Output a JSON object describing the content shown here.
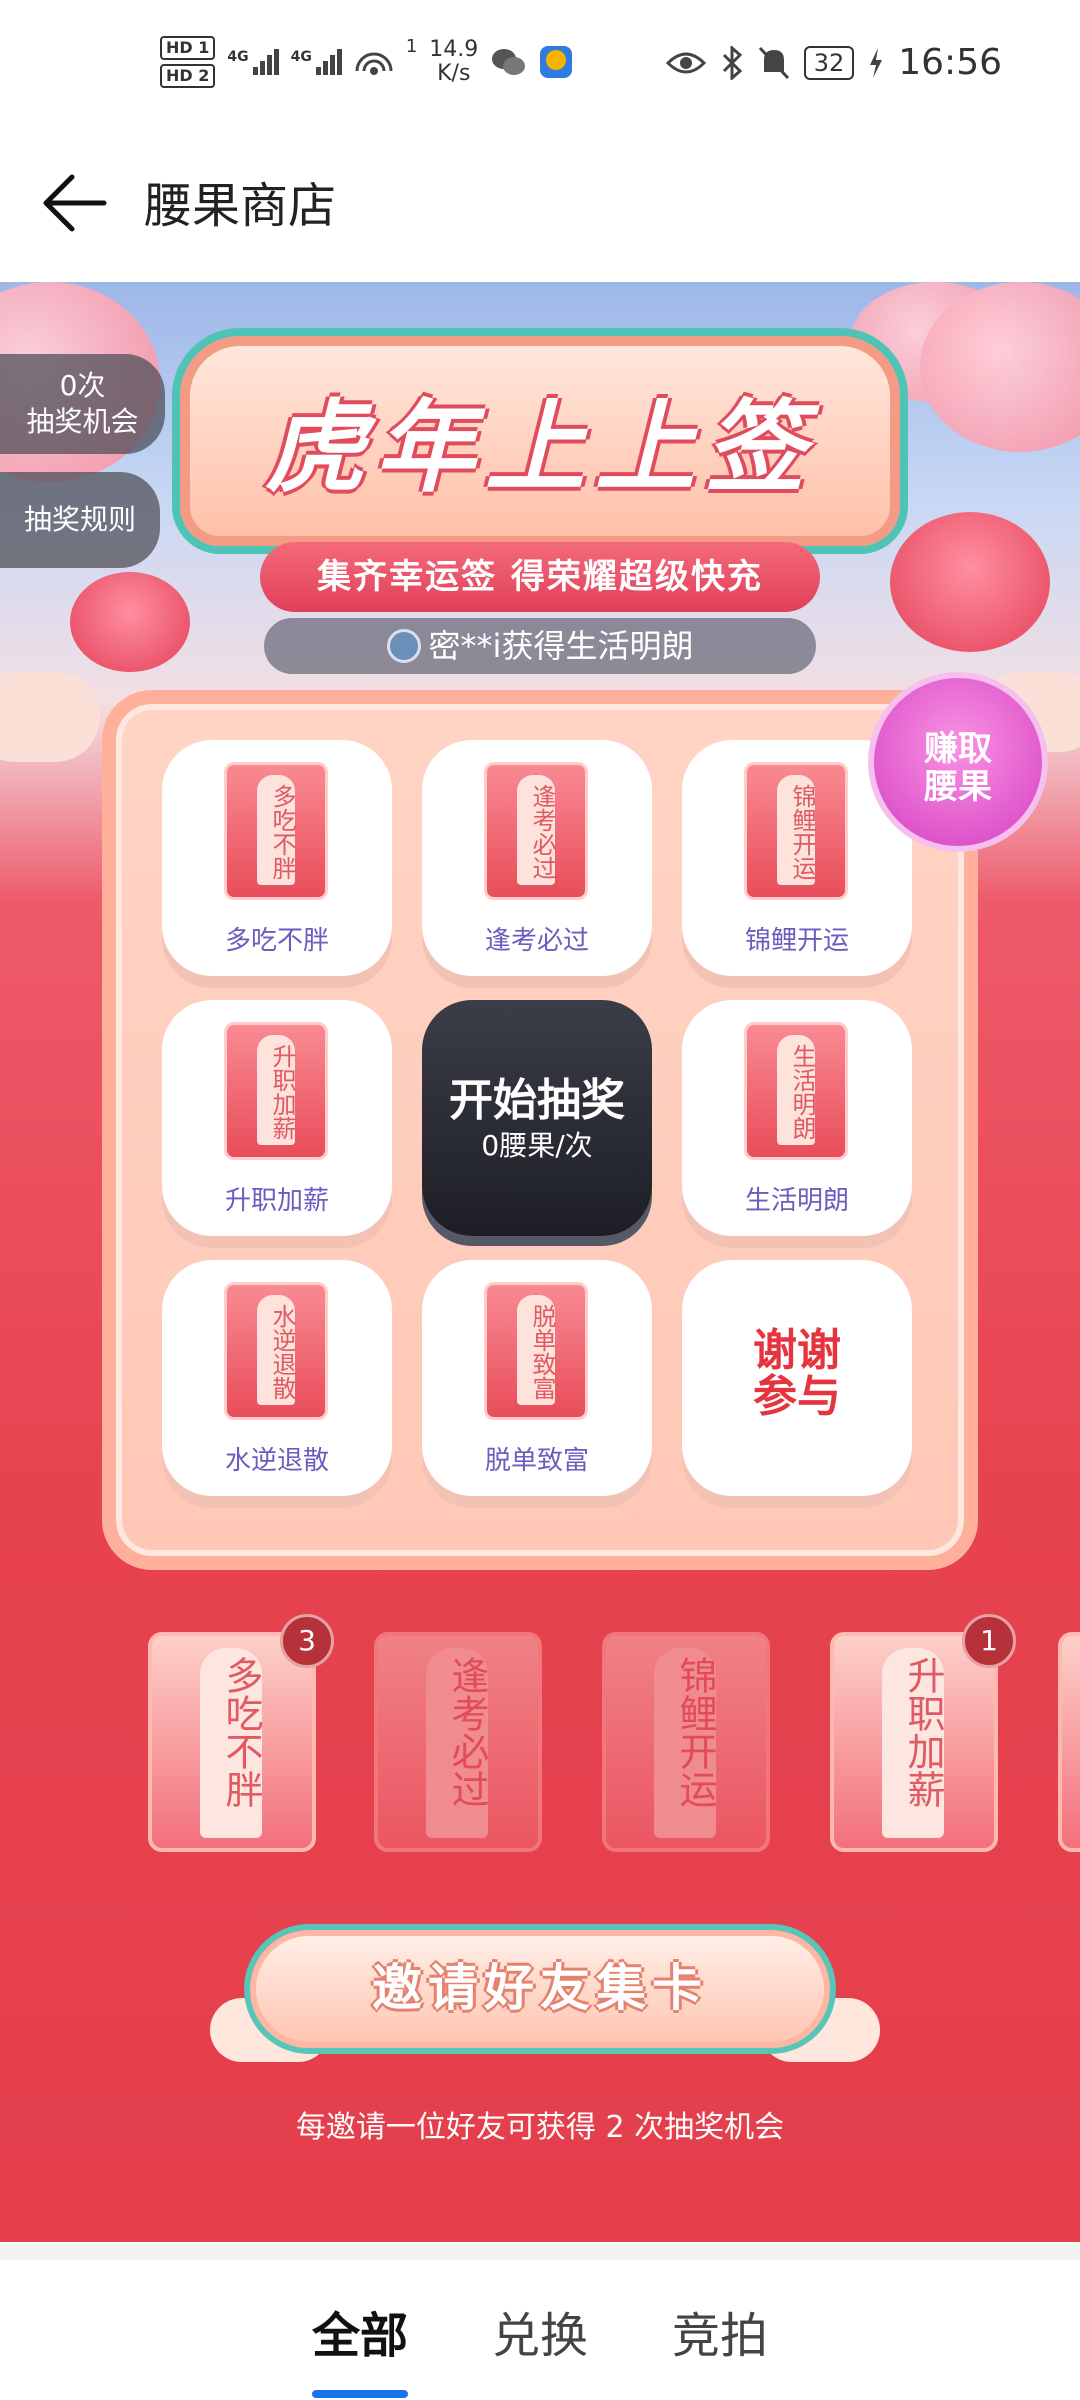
{
  "status_bar": {
    "hd1": "HD 1",
    "hd2": "HD 2",
    "net1": "4G",
    "net2": "4G",
    "hotspot_count": "1",
    "rate_value": "14.9",
    "rate_unit": "K/s",
    "battery": "32",
    "time": "16:56"
  },
  "header": {
    "title": "腰果商店"
  },
  "side": {
    "chance_count": "0次",
    "chance_label": "抽奖机会",
    "rules": "抽奖规则"
  },
  "banner": {
    "title": "虎年上上签",
    "subtitle": "集齐幸运签 得荣耀超级快充"
  },
  "winner_text": "密**i获得生活明朗",
  "earn_button": {
    "line1": "赚取",
    "line2": "腰果"
  },
  "grid": {
    "cells": [
      {
        "card": "多吃不胖",
        "label": "多吃不胖"
      },
      {
        "card": "逢考必过",
        "label": "逢考必过"
      },
      {
        "card": "锦鲤开运",
        "label": "锦鲤开运"
      },
      {
        "card": "升职加薪",
        "label": "升职加薪"
      },
      {
        "card": "生活明朗",
        "label": "生活明朗"
      },
      {
        "card": "水逆退散",
        "label": "水逆退散"
      },
      {
        "card": "脱单致富",
        "label": "脱单致富"
      }
    ],
    "start_title": "开始抽奖",
    "start_cost": "0腰果/次",
    "thanks_line1": "谢谢",
    "thanks_line2": "参与"
  },
  "collection": [
    {
      "text": "多吃不胖",
      "count": "3"
    },
    {
      "text": "逢考必过",
      "count": ""
    },
    {
      "text": "锦鲤开运",
      "count": ""
    },
    {
      "text": "升职加薪",
      "count": "1"
    }
  ],
  "invite": {
    "button": "邀请好友集卡",
    "note": "每邀请一位好友可获得 2 次抽奖机会"
  },
  "tabs": {
    "all": "全部",
    "exchange": "兑换",
    "auction": "竞拍",
    "active": "全部"
  },
  "colors": {
    "accent_red": "#e43e4b",
    "tab_underline": "#1a73e8"
  }
}
